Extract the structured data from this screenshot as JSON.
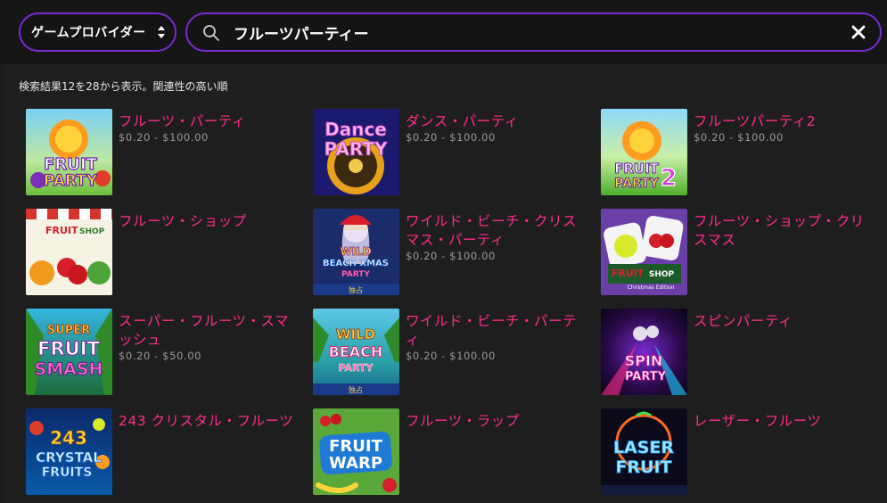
{
  "header": {
    "provider_label": "ゲームプロバイダー",
    "search_value": "フルーツパーティー"
  },
  "results": {
    "summary": "検索結果12を28から表示。関連性の高い順"
  },
  "games": [
    {
      "title": "フルーツ・パーティ",
      "bet": "$0.20 - $100.00",
      "thumb": "FRUIT PARTY"
    },
    {
      "title": "ダンス・パーティ",
      "bet": "$0.20 - $100.00",
      "thumb": "Dance PARTY"
    },
    {
      "title": "フルーツパーティ2",
      "bet": "$0.20 - $100.00",
      "thumb": "FRUIT PARTY 2"
    },
    {
      "title": "フルーツ・ショップ",
      "bet": "",
      "thumb": "FRUIT SHOP"
    },
    {
      "title": "ワイルド・ビーチ・クリスマス・パーティ",
      "bet": "$0.20 - $100.00",
      "thumb": "WILD BEACH XMAS PARTY 独占"
    },
    {
      "title": "フルーツ・ショップ・クリスマス",
      "bet": "",
      "thumb": "FRUIT SHOP Christmas Edition"
    },
    {
      "title": "スーパー・フルーツ・スマッシュ",
      "bet": "$0.20 - $50.00",
      "thumb": "SUPER FRUIT SMASH"
    },
    {
      "title": "ワイルド・ビーチ・パーティ",
      "bet": "$0.20 - $100.00",
      "thumb": "WILD BEACH PARTY 独占"
    },
    {
      "title": "スピンパーティ",
      "bet": "",
      "thumb": "SPIN PARTY"
    },
    {
      "title": "243 クリスタル・フルーツ",
      "bet": "",
      "thumb": "243 CRYSTAL FRUITS"
    },
    {
      "title": "フルーツ・ラップ",
      "bet": "",
      "thumb": "FRUIT WARP"
    },
    {
      "title": "レーザー・フルーツ",
      "bet": "",
      "thumb": "LASER FRUIT"
    }
  ],
  "thumb_text": {
    "fp1": "FRUIT",
    "fp2": "PARTY",
    "dp1": "Dance",
    "dp2": "PARTY",
    "fp2_1": "FRUIT",
    "fp2_2": "PARTY",
    "fp2_3": "2",
    "fs1": "FRUIT",
    "fs2": "SHOP",
    "wbx1": "WILD",
    "wbx2": "BEACH XMAS",
    "wbx3": "PARTY",
    "wbx4": "独占",
    "fsc1": "FRUIT",
    "fsc2": "SHOP",
    "fsc3": "Christmas Edition",
    "sfs1": "SUPER",
    "sfs2": "FRUIT",
    "sfs3": "SMASH",
    "wbp1": "WILD",
    "wbp2": "BEACH",
    "wbp3": "PARTY",
    "wbp4": "独占",
    "sp1": "SPIN",
    "sp2": "PARTY",
    "cf1": "243",
    "cf2": "CRYSTAL",
    "cf3": "FRUITS",
    "fw1": "FRUIT",
    "fw2": "WARP",
    "lf1": "LASER",
    "lf2": "FRUIT"
  },
  "colors": {
    "accent_border": "#7a2bd1",
    "title_pink": "#ff2d8a",
    "bet_gray": "#9a9a9a"
  }
}
